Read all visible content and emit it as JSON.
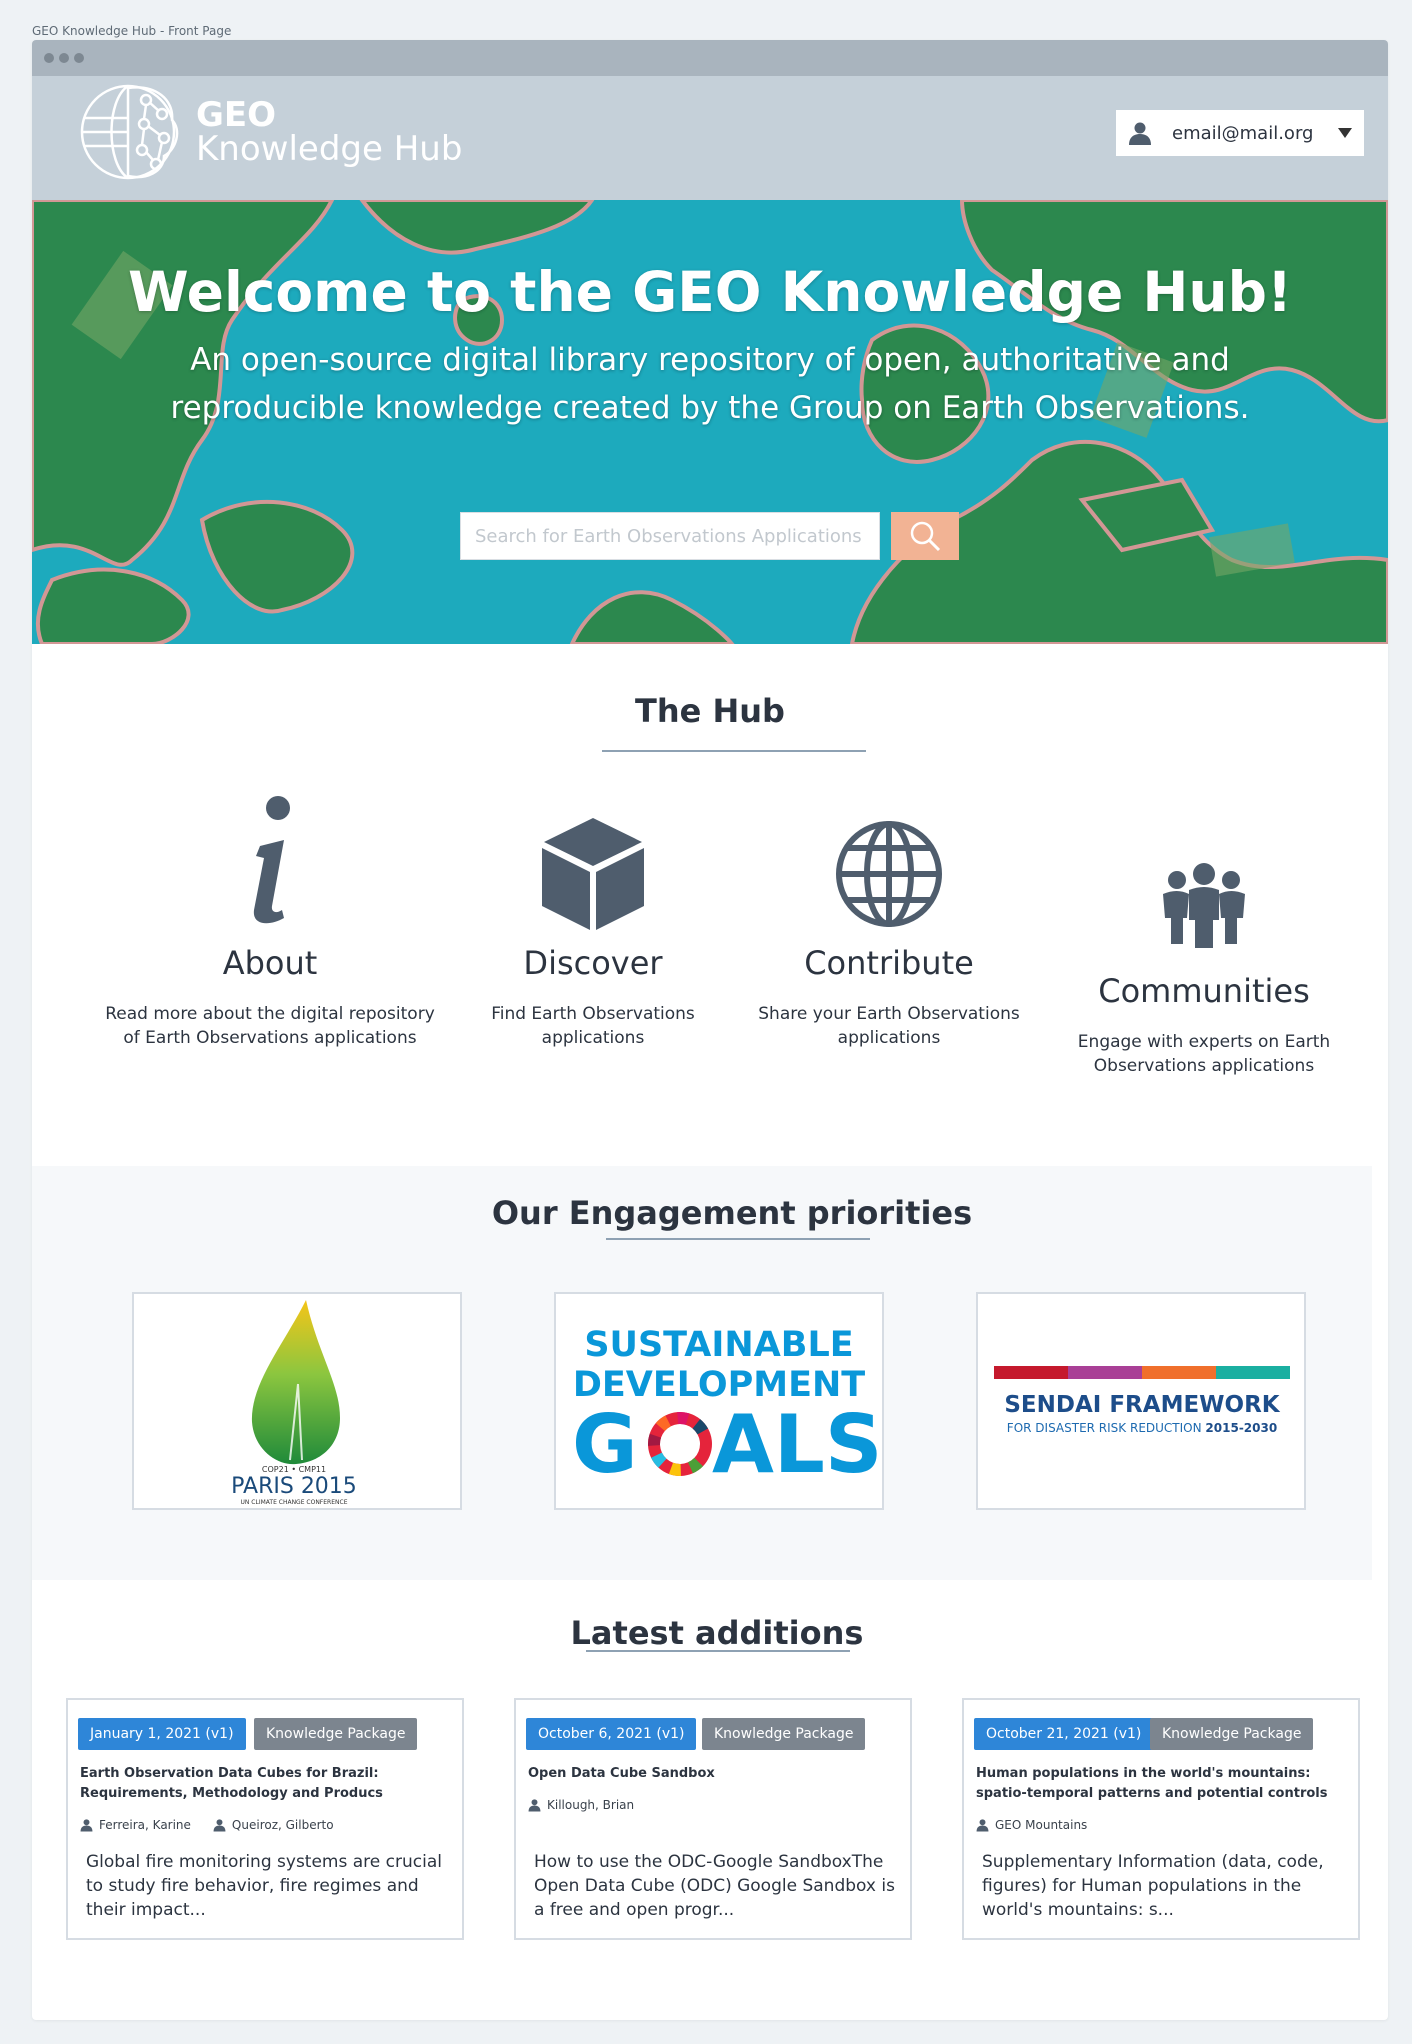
{
  "page_caption": "GEO Knowledge Hub - Front Page",
  "header": {
    "logo_geo": "GEO",
    "logo_subtitle": "Knowledge Hub",
    "user_email": "email@mail.org"
  },
  "hero": {
    "title": "Welcome to the GEO Knowledge Hub!",
    "subtitle": "An open-source digital library repository of open, authoritative and reproducible knowledge created by the Group on Earth Observations.",
    "search_placeholder": "Search for Earth Observations Applications",
    "colors": {
      "water": "#1fb3c7",
      "land": "#2d8a4e"
    }
  },
  "hub": {
    "title": "The Hub",
    "items": [
      {
        "icon": "info-icon",
        "label": "About",
        "description": "Read more about the digital repository of Earth Observations applications"
      },
      {
        "icon": "cube-icon",
        "label": "Discover",
        "description": "Find Earth Observations applications"
      },
      {
        "icon": "globe-icon",
        "label": "Contribute",
        "description": "Share your Earth Observations applications"
      },
      {
        "icon": "people-icon",
        "label": "Communities",
        "description": "Engage with experts on Earth Observations applications"
      }
    ]
  },
  "engagement": {
    "title": "Our Engagement priorities",
    "cards": [
      {
        "name": "paris-2015",
        "line1": "COP21 • CMP11",
        "line2": "PARIS 2015",
        "line3": "UN CLIMATE CHANGE CONFERENCE"
      },
      {
        "name": "sdg",
        "line1": "SUSTAINABLE",
        "line2": "DEVELOPMENT",
        "line3": "G",
        "line4": "ALS"
      },
      {
        "name": "sendai",
        "line1": "SENDAI FRAMEWORK",
        "line2": "FOR DISASTER RISK REDUCTION ",
        "line3": "2015-2030"
      }
    ]
  },
  "additions": {
    "title": "Latest additions",
    "items": [
      {
        "date": "January 1, 2021 (v1)",
        "type": "Knowledge Package",
        "title": "Earth Observation Data Cubes for Brazil: Requirements, Methodology and Producs",
        "authors": [
          "Ferreira, Karine",
          "Queiroz, Gilberto"
        ],
        "description": "Global fire monitoring systems are crucial to study fire behavior, fire regimes and their impact..."
      },
      {
        "date": "October 6, 2021 (v1)",
        "type": "Knowledge Package",
        "title": "Open Data Cube Sandbox",
        "authors": [
          "Killough, Brian"
        ],
        "description": "How to use the ODC-Google SandboxThe Open Data Cube (ODC) Google Sandbox is a free and open progr..."
      },
      {
        "date": "October 21, 2021 (v1)",
        "type": "Knowledge Package",
        "title": "Human populations in the world's mountains: spatio-temporal patterns and potential controls",
        "authors": [
          "GEO Mountains"
        ],
        "description": "Supplementary Information (data, code, figures) for Human populations in the world's mountains: s..."
      }
    ]
  },
  "theme": {
    "primary_text": "#2c3440",
    "icon": "#4f5d6d",
    "tag_blue": "#2e86d8",
    "tag_grey": "#7c858f",
    "search_button": "#f2b394"
  }
}
